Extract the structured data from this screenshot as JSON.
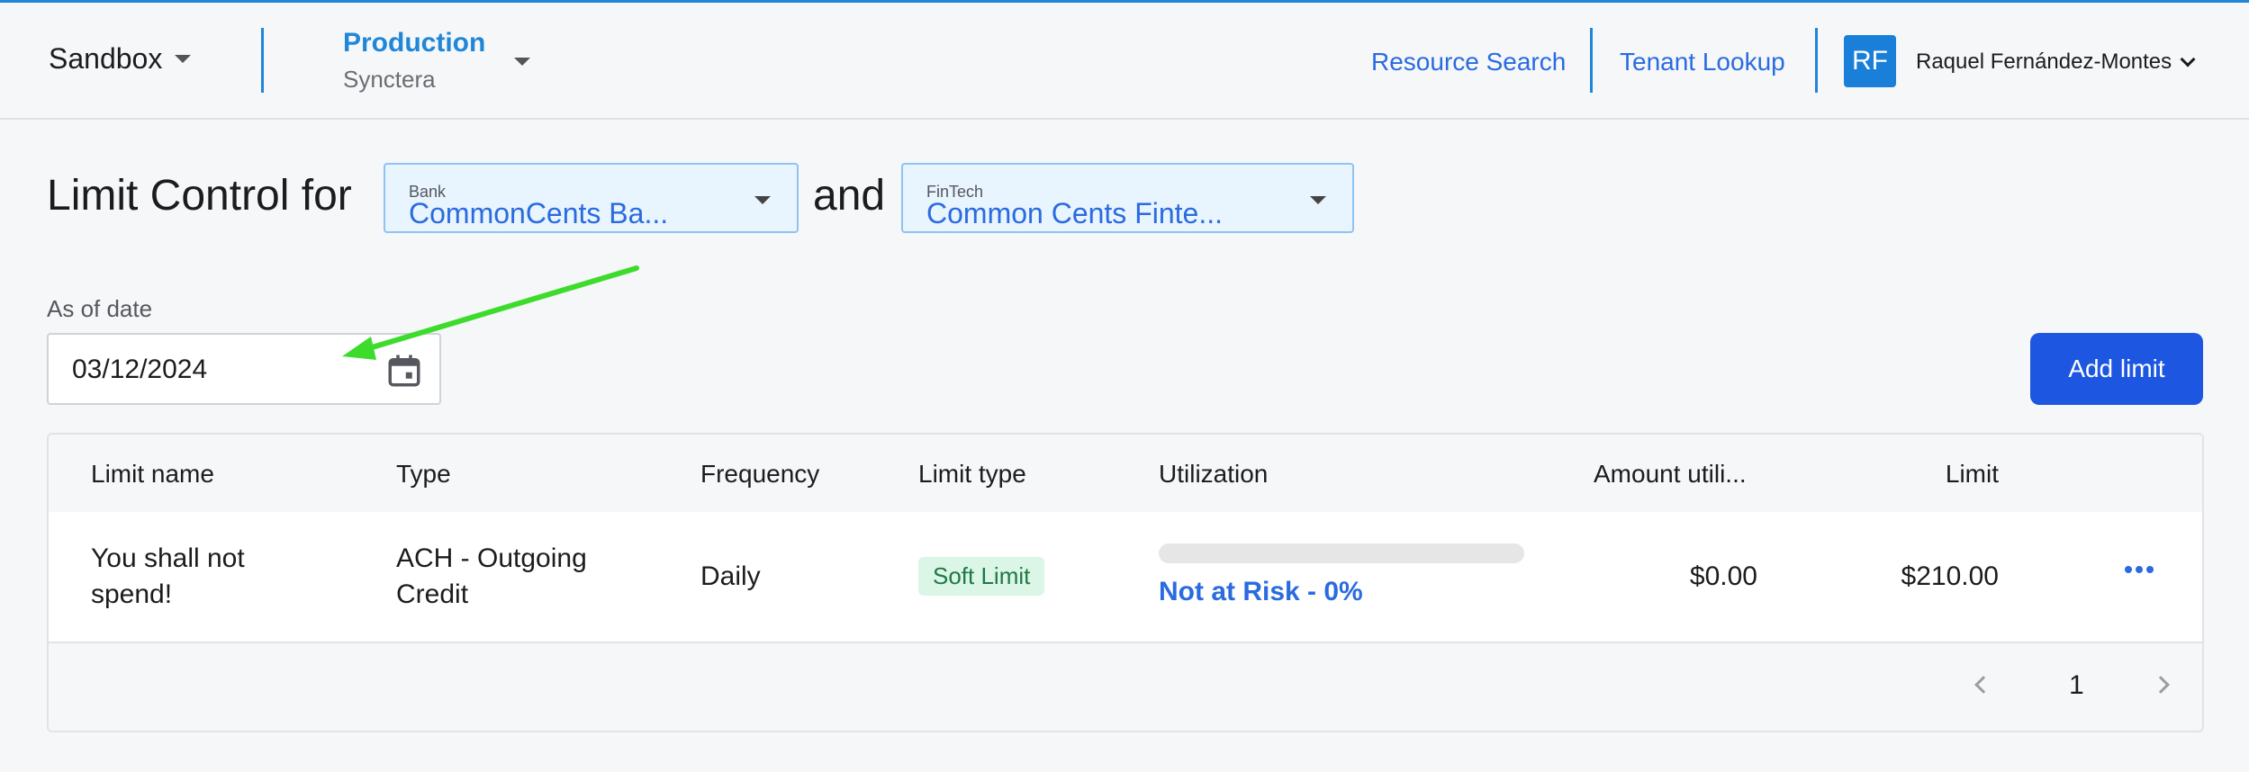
{
  "header": {
    "environment": "Sandbox",
    "org_name": "Production",
    "org_sub": "Synctera",
    "nav": {
      "resource_search": "Resource Search",
      "tenant_lookup": "Tenant Lookup"
    },
    "user": {
      "initials": "RF",
      "name": "Raquel Fernández-Montes"
    }
  },
  "page": {
    "title": "Limit Control for",
    "and_text": "and",
    "bank_select": {
      "label": "Bank",
      "value": "CommonCents Ba..."
    },
    "fintech_select": {
      "label": "FinTech",
      "value": "Common Cents Finte..."
    },
    "date_label": "As of date",
    "date_value": "03/12/2024",
    "add_button": "Add limit"
  },
  "table": {
    "columns": [
      "Limit name",
      "Type",
      "Frequency",
      "Limit type",
      "Utilization",
      "Amount utili...",
      "Limit"
    ],
    "rows": [
      {
        "limit_name_line1": "You shall not",
        "limit_name_line2": "spend!",
        "type_line1": "ACH - Outgoing",
        "type_line2": "Credit",
        "frequency": "Daily",
        "limit_type": "Soft Limit",
        "utilization_fraction": 0,
        "utilization_text": "Not at Risk - 0%",
        "amount_utilized": "$0.00",
        "limit": "$210.00"
      }
    ],
    "pagination": {
      "current_page": "1"
    }
  },
  "colors": {
    "accent": "#1f86d8",
    "primary_button": "#1d56e0",
    "link": "#2a6be0",
    "badge_bg": "#dbf5e6",
    "badge_text": "#1d7a45",
    "annotation_arrow": "#3ddc2c"
  }
}
